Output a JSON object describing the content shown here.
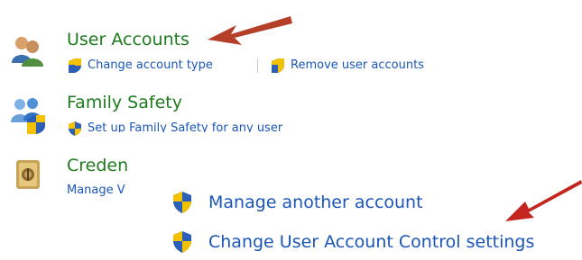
{
  "categories": [
    {
      "title": "User Accounts",
      "links": [
        "Change account type",
        "Remove user accounts"
      ],
      "icon": "users-icon"
    },
    {
      "title": "Family Safety",
      "links": [
        "Set up Family Safety for any user"
      ],
      "icon": "family-safety-icon"
    },
    {
      "title": "Creden",
      "links": [
        "Manage V"
      ],
      "icon": "credential-vault-icon"
    }
  ],
  "overlay_links": [
    "Manage another account",
    "Change User Account Control settings"
  ],
  "colors": {
    "category_title": "#1e7b1e",
    "link": "#1a56b8",
    "arrow": "#b5402a"
  }
}
